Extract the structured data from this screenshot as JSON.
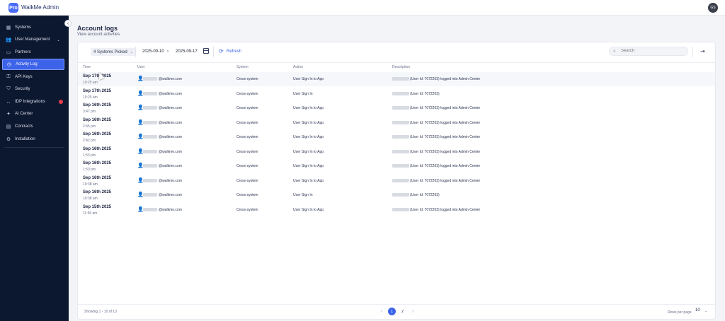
{
  "app": {
    "logo_text": "Pro",
    "title": "WalkMe Admin",
    "avatar_initials": "GS"
  },
  "sidebar": {
    "collapse_icon": "chevron-left-icon",
    "items": [
      {
        "label": "Systems",
        "icon": "systems-icon",
        "glyph": "▦"
      },
      {
        "label": "User Management",
        "icon": "users-icon",
        "glyph": "👥",
        "chevron": "⌄"
      },
      {
        "label": "Partners",
        "icon": "partners-icon",
        "glyph": "▭"
      },
      {
        "label": "Activity Log",
        "icon": "activity-log-icon",
        "glyph": "◷",
        "active": true
      },
      {
        "label": "API Keys",
        "icon": "api-keys-icon",
        "glyph": "⚿"
      },
      {
        "label": "Security",
        "icon": "security-icon",
        "glyph": "⛉"
      },
      {
        "label": "IDP Integrations",
        "icon": "idp-icon",
        "glyph": "↔",
        "badge": true
      },
      {
        "label": "AI Center",
        "icon": "ai-center-icon",
        "glyph": "✦"
      },
      {
        "label": "Contracts",
        "icon": "contracts-icon",
        "glyph": "▤"
      },
      {
        "label": "Installation",
        "icon": "installation-icon",
        "glyph": "⚙"
      }
    ]
  },
  "page": {
    "title": "Account logs",
    "subtitle": "View account activities"
  },
  "filters": {
    "systems_picked": "4 Systems Picked",
    "date_from": "2025-09-10",
    "arrow": "›",
    "date_to": "2025-09-17",
    "refresh_label": "Refresh",
    "search_placeholder": "Search"
  },
  "table": {
    "headers": [
      "Time",
      "User",
      "System",
      "Action",
      "Description"
    ],
    "rows": [
      {
        "date": "Sep 17th 2025",
        "time": "10:25 am",
        "user": "@walkme.com",
        "system": "Cross-system",
        "action": "User Sign In to App",
        "description": "(User Id: 7072203) logged into Admin Center"
      },
      {
        "date": "Sep 17th 2025",
        "time": "10:25 am",
        "user": "@walkme.com",
        "system": "Cross-system",
        "action": "User Sign In",
        "description": "(User Id: 7072203)"
      },
      {
        "date": "Sep 16th 2025",
        "time": "3:47 pm",
        "user": "@walkme.com",
        "system": "Cross-system",
        "action": "User Sign In to App",
        "description": "(User Id: 7072203) logged into Admin Center"
      },
      {
        "date": "Sep 16th 2025",
        "time": "2:45 pm",
        "user": "@walkme.com",
        "system": "Cross-system",
        "action": "User Sign In to App",
        "description": "(User Id: 7072203) logged into Admin Center"
      },
      {
        "date": "Sep 16th 2025",
        "time": "2:42 pm",
        "user": "@walkme.com",
        "system": "Cross-system",
        "action": "User Sign In to App",
        "description": "(User Id: 7072203) logged into Admin Center"
      },
      {
        "date": "Sep 16th 2025",
        "time": "1:53 pm",
        "user": "@walkme.com",
        "system": "Cross-system",
        "action": "User Sign In to App",
        "description": "(User Id: 7072203) logged into Admin Center"
      },
      {
        "date": "Sep 16th 2025",
        "time": "1:53 pm",
        "user": "@walkme.com",
        "system": "Cross-system",
        "action": "User Sign In to App",
        "description": "(User Id: 7072203) logged into Admin Center"
      },
      {
        "date": "Sep 16th 2025",
        "time": "10:38 am",
        "user": "@walkme.com",
        "system": "Cross-system",
        "action": "User Sign In to App",
        "description": "(User Id: 7072203) logged into Admin Center"
      },
      {
        "date": "Sep 16th 2025",
        "time": "10:38 am",
        "user": "@walkme.com",
        "system": "Cross-system",
        "action": "User Sign In",
        "description": "(User Id: 7072203)"
      },
      {
        "date": "Sep 15th 2025",
        "time": "11:56 am",
        "user": "@walkme.com",
        "system": "Cross-system",
        "action": "User Sign In to App",
        "description": "(User Id: 7072203) logged into Admin Center"
      }
    ]
  },
  "pagination": {
    "showing": "Showing 1 - 10 of 13",
    "prev": "‹",
    "pages": [
      "1",
      "2"
    ],
    "current": "1",
    "next": "›",
    "rows_per_page_label": "Rows per page",
    "rows_per_page": "10"
  },
  "colors": {
    "sidebar": "#0c1730",
    "accent": "#3d63e8",
    "badge": "#ea3b4b"
  }
}
